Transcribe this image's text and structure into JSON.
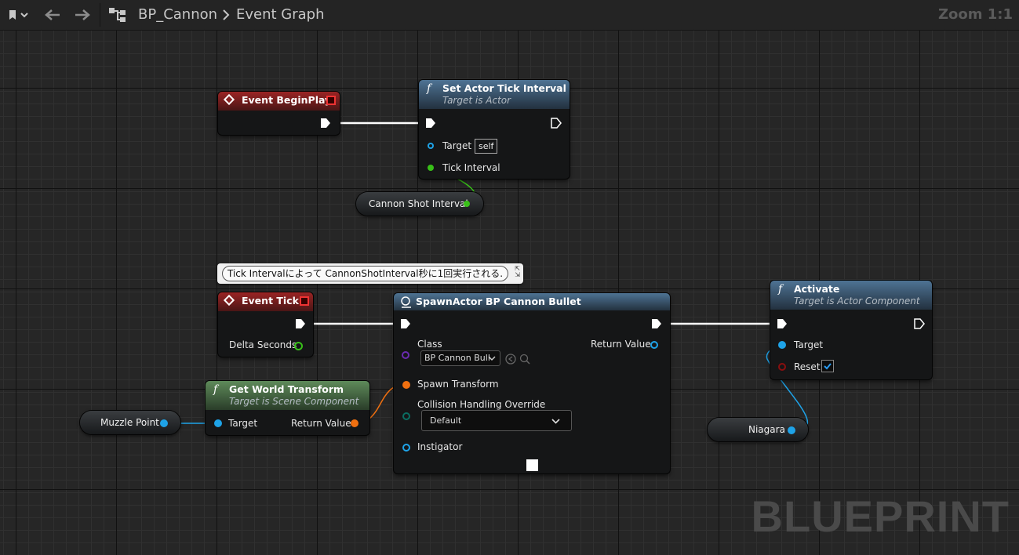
{
  "toolbar": {
    "breadcrumb_root": "BP_Cannon",
    "breadcrumb_current": "Event Graph",
    "zoom": "Zoom 1:1"
  },
  "comment": {
    "text": "Tick Intervalによって CannonShotInterval秒に1回実行される."
  },
  "nodes": {
    "begin_play": {
      "title": "Event BeginPlay"
    },
    "set_tick": {
      "title": "Set Actor Tick Interval",
      "subtitle": "Target is Actor",
      "target_label": "Target",
      "target_value": "self",
      "tick_interval_label": "Tick Interval"
    },
    "cannon_shot_interval": {
      "label": "Cannon Shot Interval"
    },
    "event_tick": {
      "title": "Event Tick",
      "delta_label": "Delta Seconds"
    },
    "spawn_actor": {
      "title": "SpawnActor BP Cannon Bullet",
      "class_label": "Class",
      "class_value": "BP Cannon Bull",
      "return_label": "Return Value",
      "spawn_transform_label": "Spawn Transform",
      "collision_label": "Collision Handling Override",
      "collision_value": "Default",
      "instigator_label": "Instigator"
    },
    "get_world_transform": {
      "title": "Get World Transform",
      "subtitle": "Target is Scene Component",
      "target_label": "Target",
      "return_label": "Return Value"
    },
    "muzzle_point": {
      "label": "Muzzle Point"
    },
    "activate": {
      "title": "Activate",
      "subtitle": "Target is Actor Component",
      "target_label": "Target",
      "reset_label": "Reset"
    },
    "niagara": {
      "label": "Niagara"
    }
  },
  "colors": {
    "exec": "#ffffff",
    "object_pin": "#1ea3e8",
    "float_pin": "#38c018",
    "transform_pin": "#f07010",
    "bool_pin": "#8a0f0f",
    "class_pin": "#6a2bb0",
    "byte_pin": "#0a6d62",
    "event_header": "#8a1d1d",
    "function_header": "#3d5b74",
    "pure_header": "#3c5b3a"
  },
  "watermark": "BLUEPRINT"
}
